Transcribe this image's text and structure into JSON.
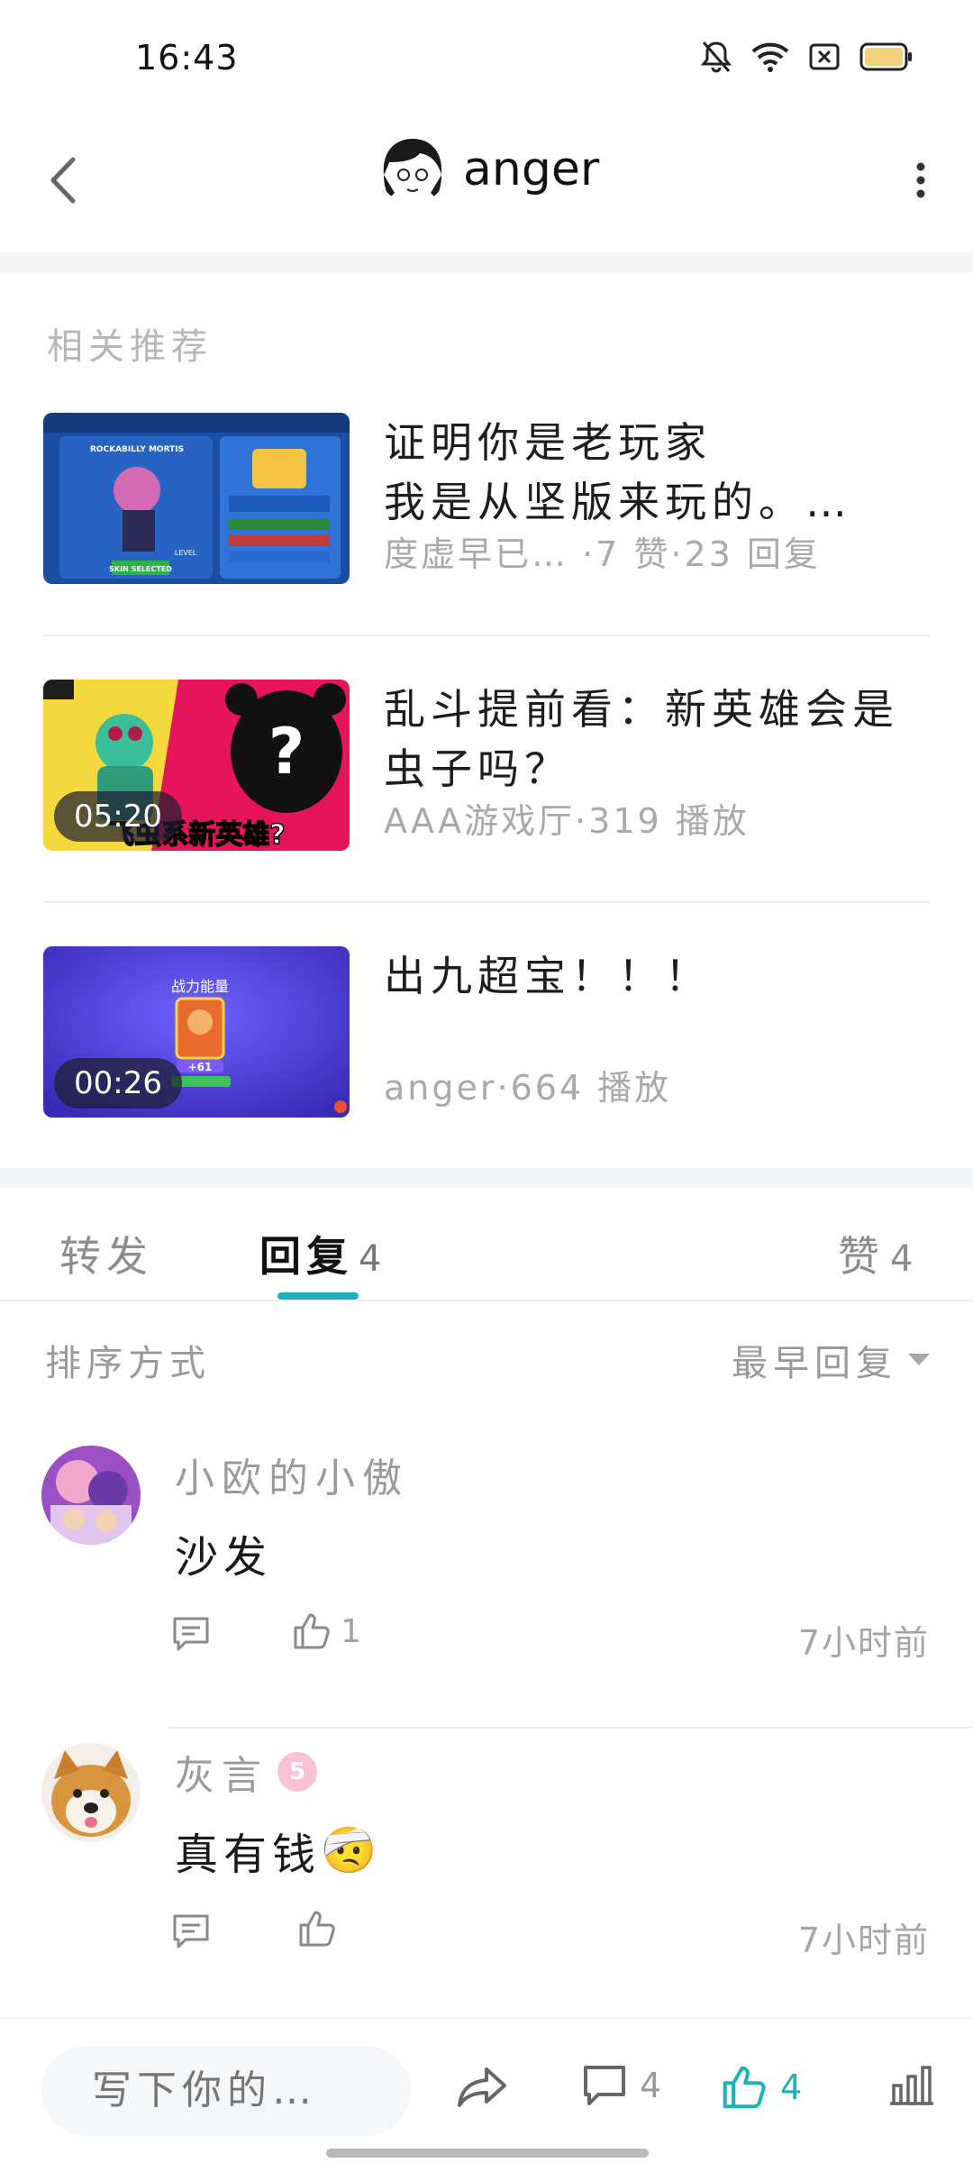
{
  "status_bar": {
    "time": "16:43"
  },
  "header": {
    "username": "anger"
  },
  "related": {
    "section_title": "相关推荐",
    "items": [
      {
        "title": "证明你是老玩家",
        "subtitle": "我是从坚版来玩的。…",
        "meta": "度虚早已… ·7 赞·23 回复",
        "thumb_text": [
          "ROCKABILLY MORTIS",
          "SKIN SELECTED",
          "LEVEL"
        ]
      },
      {
        "title": "乱斗提前看：新英雄会是虫子吗？",
        "meta": "AAA游戏厅·319 播放",
        "duration": "05:20",
        "thumb_text": [
          "飞虫系新英雄?",
          "?"
        ]
      },
      {
        "title": "出九超宝！！！",
        "meta": "anger·664 播放",
        "duration": "00:26",
        "thumb_text": [
          "战力能量",
          "+61"
        ]
      }
    ]
  },
  "tabs": {
    "forward": {
      "label": "转发"
    },
    "reply": {
      "label": "回复",
      "count": "4"
    },
    "like": {
      "label": "赞",
      "count": "4"
    }
  },
  "sort": {
    "label": "排序方式",
    "value": "最早回复"
  },
  "comments": [
    {
      "user": "小欧的小傲",
      "text": "沙发",
      "likes": "1",
      "time": "7小时前"
    },
    {
      "user": "灰言",
      "text": "真有钱",
      "emoji": "🤕",
      "level_badge": "5",
      "likes": "",
      "time": "7小时前"
    }
  ],
  "bottom_bar": {
    "placeholder": "写下你的…",
    "comment_count": "4",
    "like_count": "4"
  },
  "colors": {
    "accent": "#1fb2b8"
  }
}
